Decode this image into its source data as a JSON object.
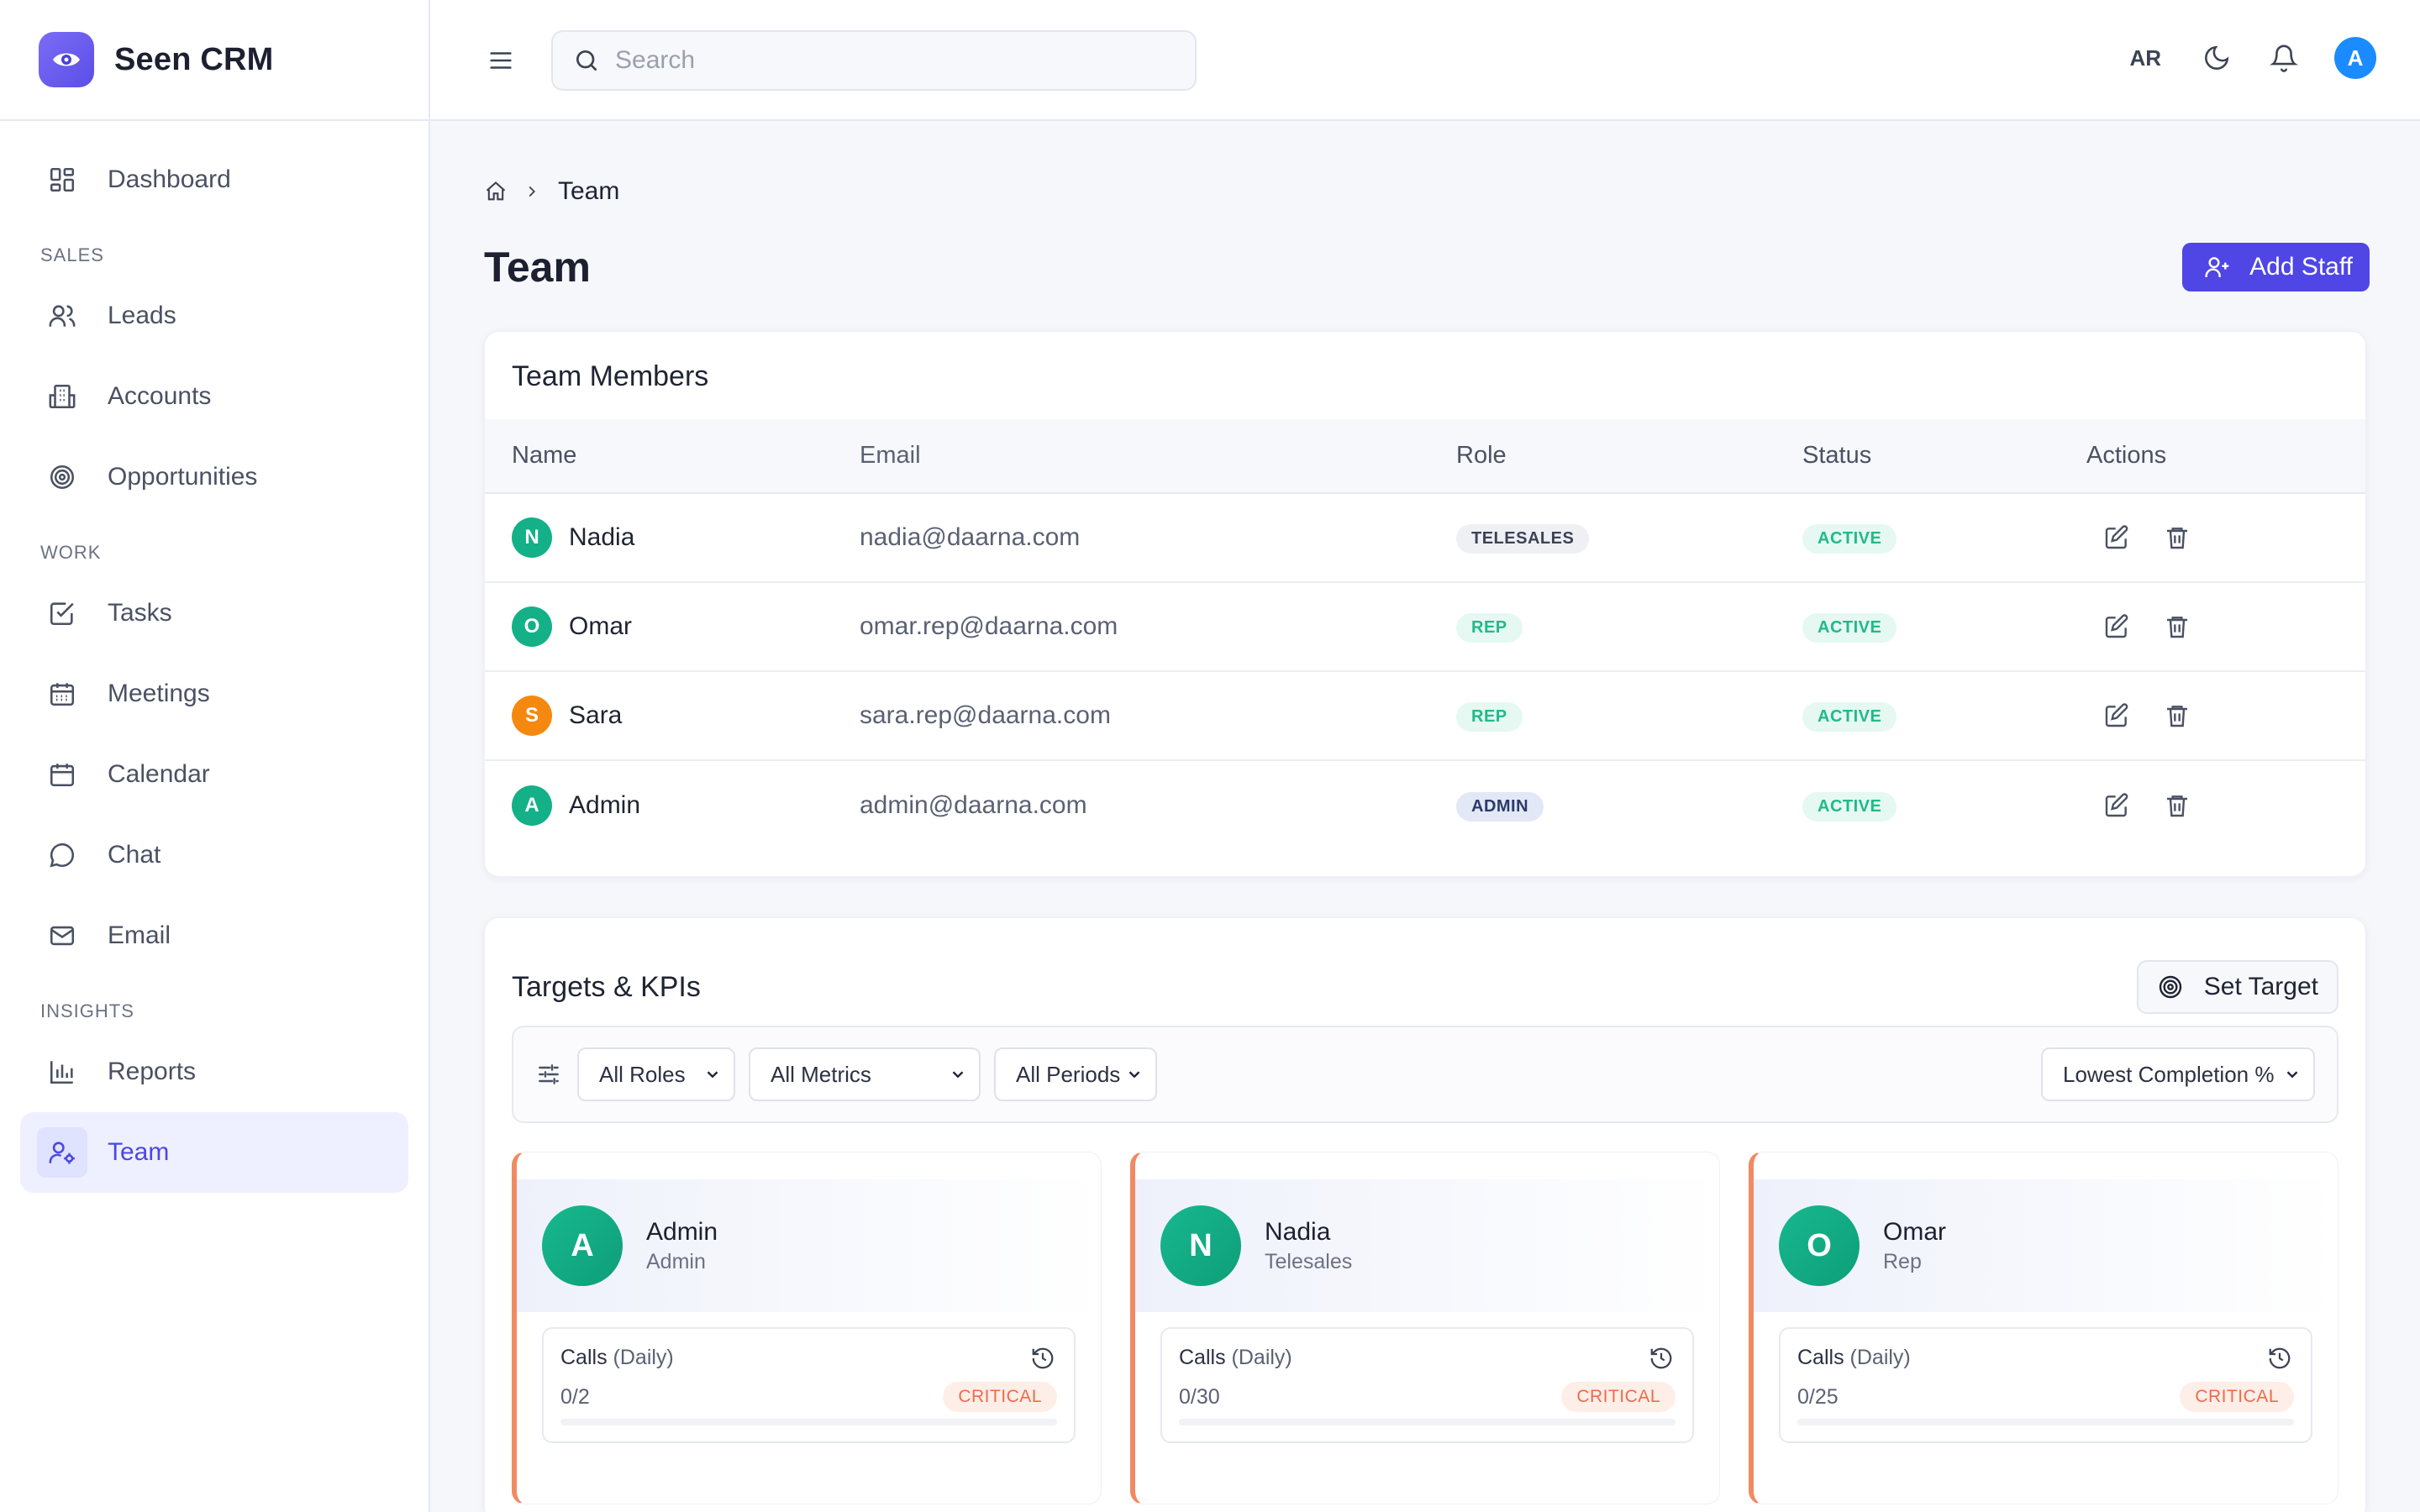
{
  "brand": {
    "name": "Seen CRM"
  },
  "nav": {
    "dashboard": "Dashboard",
    "section_sales": "SALES",
    "leads": "Leads",
    "accounts": "Accounts",
    "opportunities": "Opportunities",
    "section_work": "WORK",
    "tasks": "Tasks",
    "meetings": "Meetings",
    "calendar": "Calendar",
    "chat": "Chat",
    "email": "Email",
    "section_insights": "INSIGHTS",
    "reports": "Reports",
    "team": "Team",
    "active_item": "team"
  },
  "header": {
    "search_placeholder": "Search",
    "language": "AR",
    "user_initial": "A",
    "avatar_color": "#1a8cff"
  },
  "page": {
    "breadcrumb": "Team",
    "title": "Team",
    "add_staff": "Add Staff"
  },
  "members": {
    "title": "Team Members",
    "columns": {
      "name": "Name",
      "email": "Email",
      "role": "Role",
      "status": "Status",
      "actions": "Actions"
    },
    "rows": [
      {
        "initial": "N",
        "name": "Nadia",
        "email": "nadia@daarna.com",
        "role": "TELESALES",
        "status": "ACTIVE",
        "avatar_color": "#14b088"
      },
      {
        "initial": "O",
        "name": "Omar",
        "email": "omar.rep@daarna.com",
        "role": "REP",
        "status": "ACTIVE",
        "avatar_color": "#14b088"
      },
      {
        "initial": "S",
        "name": "Sara",
        "email": "sara.rep@daarna.com",
        "role": "REP",
        "status": "ACTIVE",
        "avatar_color": "#f5890f"
      },
      {
        "initial": "A",
        "name": "Admin",
        "email": "admin@daarna.com",
        "role": "ADMIN",
        "status": "ACTIVE",
        "avatar_color": "#14b088"
      }
    ]
  },
  "kpis": {
    "title": "Targets & KPIs",
    "set_target": "Set Target",
    "filters": {
      "roles": "All Roles",
      "metrics": "All Metrics",
      "periods": "All Periods",
      "sort": "Lowest Completion %"
    },
    "cards": [
      {
        "initial": "A",
        "name": "Admin",
        "role": "Admin",
        "metric": "Calls",
        "period": "(Daily)",
        "value": "0/2",
        "status": "CRITICAL",
        "progress": 0
      },
      {
        "initial": "N",
        "name": "Nadia",
        "role": "Telesales",
        "metric": "Calls",
        "period": "(Daily)",
        "value": "0/30",
        "status": "CRITICAL",
        "progress": 0
      },
      {
        "initial": "O",
        "name": "Omar",
        "role": "Rep",
        "metric": "Calls",
        "period": "(Daily)",
        "value": "0/25",
        "status": "CRITICAL",
        "progress": 0
      }
    ]
  },
  "colors": {
    "accent": "#4f46e5",
    "critical": "#ef6b4a",
    "success": "#21b98a"
  }
}
